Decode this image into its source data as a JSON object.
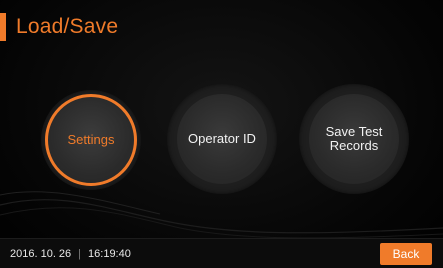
{
  "header": {
    "title": "Load/Save"
  },
  "menu": {
    "settings_label": "Settings",
    "operator_label": "Operator ID",
    "save_records_line1": "Save Test",
    "save_records_line2": "Records",
    "selected": "Settings"
  },
  "status_bar": {
    "date": "2016. 10. 26",
    "separator": "|",
    "time": "16:19:40",
    "back_label": "Back"
  },
  "colors": {
    "accent": "#f07b2a",
    "button_fill": "#2e2e2e",
    "background": "#000000"
  }
}
